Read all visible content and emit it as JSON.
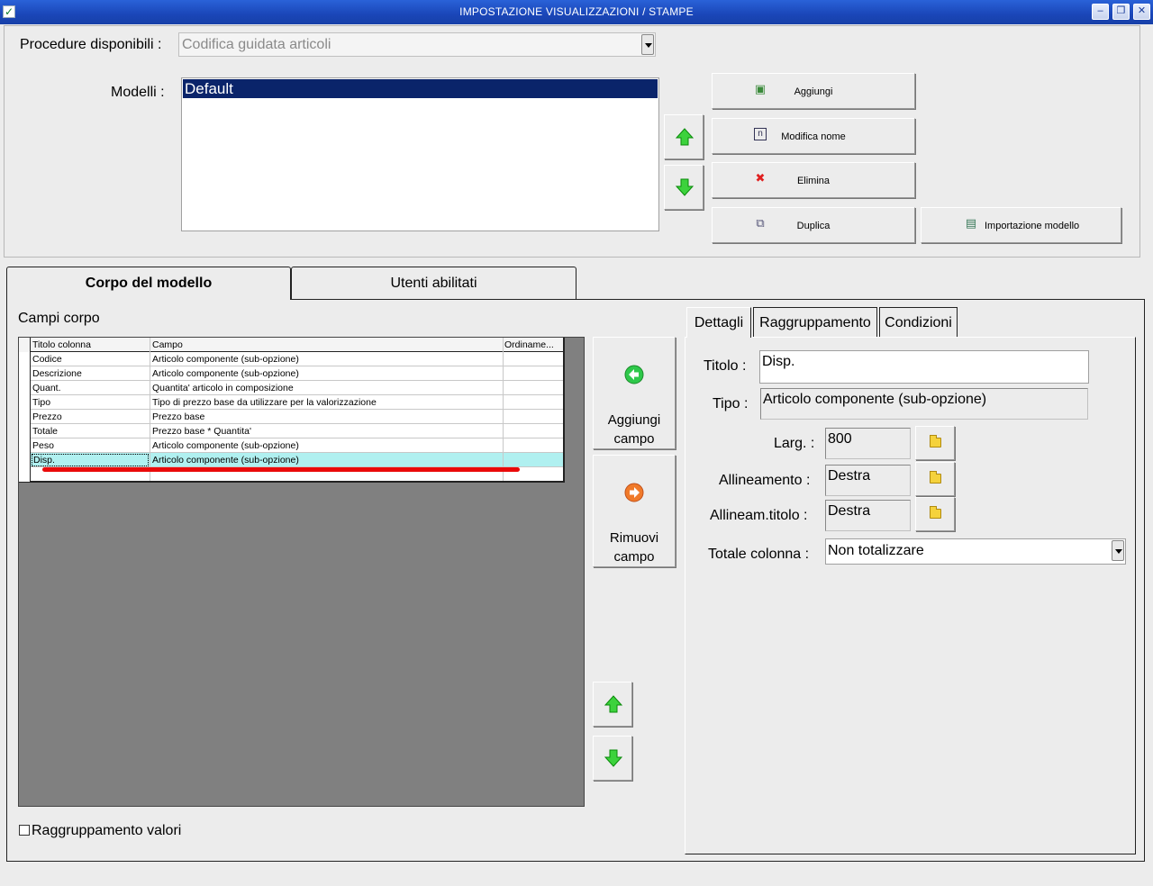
{
  "window": {
    "title": "IMPOSTAZIONE VISUALIZZAZIONI / STAMPE"
  },
  "top": {
    "procedure_label": "Procedure disponibili :",
    "procedure_value": "Codifica guidata articoli",
    "modelli_label": "Modelli :",
    "modelli": [
      "Default"
    ],
    "buttons": {
      "aggiungi": "Aggiungi",
      "modifica_nome": "Modifica nome",
      "elimina": "Elimina",
      "duplica": "Duplica",
      "importazione": "Importazione modello"
    }
  },
  "tabs": [
    "Corpo del modello",
    "Utenti abilitati"
  ],
  "campi_corpo": {
    "label": "Campi corpo",
    "columns": [
      "Titolo colonna",
      "Campo",
      "Ordiname..."
    ],
    "rows": [
      {
        "titolo": "Codice",
        "campo": "Articolo componente (sub-opzione)"
      },
      {
        "titolo": "Descrizione",
        "campo": "Articolo componente (sub-opzione)"
      },
      {
        "titolo": "Quant.",
        "campo": "Quantita' articolo in composizione"
      },
      {
        "titolo": "Tipo",
        "campo": "Tipo di prezzo base da utilizzare per la valorizzazione"
      },
      {
        "titolo": "Prezzo",
        "campo": "Prezzo base"
      },
      {
        "titolo": "Totale",
        "campo": "Prezzo base * Quantita'"
      },
      {
        "titolo": "Peso",
        "campo": "Articolo componente (sub-opzione)"
      },
      {
        "titolo": "Disp.",
        "campo": "Articolo componente (sub-opzione)"
      }
    ],
    "aggiungi_l1": "Aggiungi",
    "aggiungi_l2": "campo",
    "rimuovi_l1": "Rimuovi",
    "rimuovi_l2": "campo",
    "raggruppamento_valori": "Raggruppamento valori"
  },
  "details": {
    "tabs": [
      "Dettagli",
      "Raggruppamento",
      "Condizioni"
    ],
    "titolo_label": "Titolo :",
    "titolo_value": "Disp.",
    "tipo_label": "Tipo :",
    "tipo_value": "Articolo componente (sub-opzione)",
    "larg_label": "Larg. :",
    "larg_value": "800",
    "allineamento_label": "Allineamento :",
    "allineamento_value": "Destra",
    "allineam_titolo_label": "Allineam.titolo :",
    "allineam_titolo_value": "Destra",
    "totale_label": "Totale colonna :",
    "totale_value": "Non totalizzare"
  },
  "colors": {
    "titlebar": "#1a46b8",
    "selection": "#0a246a",
    "row_highlight": "#b0f0f0",
    "annotation": "#ea0a0a"
  }
}
